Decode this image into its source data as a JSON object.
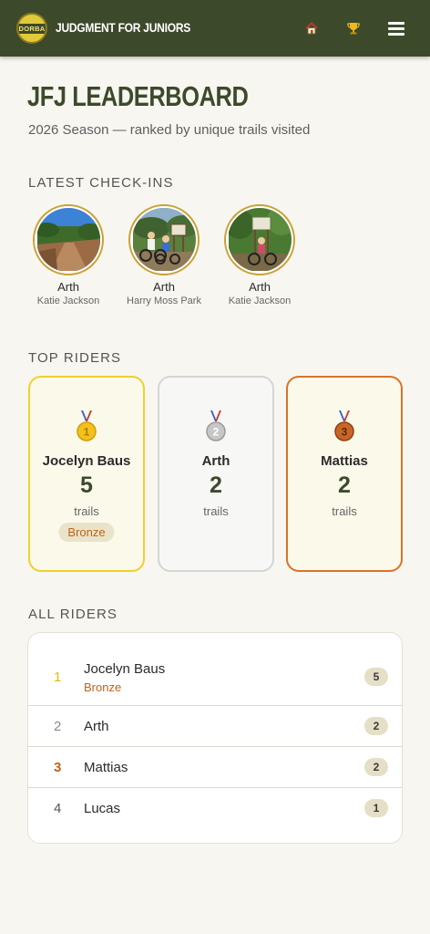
{
  "header": {
    "logo_text": "DORBA",
    "brand": "JUDGMENT FOR JUNIORS",
    "nav": [
      {
        "icon": "home-icon"
      },
      {
        "icon": "trophy-icon"
      },
      {
        "icon": "menu-icon"
      }
    ]
  },
  "page": {
    "title": "JFJ LEADERBOARD",
    "subtitle": "2026 Season — ranked by unique trails visited"
  },
  "checkins": {
    "label": "LATEST CHECK-INS",
    "items": [
      {
        "rider": "Arth",
        "trail": "Katie Jackson"
      },
      {
        "rider": "Arth",
        "trail": "Harry Moss Park"
      },
      {
        "rider": "Arth",
        "trail": "Katie Jackson"
      }
    ]
  },
  "top_riders": {
    "label": "TOP RIDERS",
    "cards": [
      {
        "place": "1",
        "name": "Jocelyn Baus",
        "count": "5",
        "unit": "trails",
        "badge": "Bronze"
      },
      {
        "place": "2",
        "name": "Arth",
        "count": "2",
        "unit": "trails"
      },
      {
        "place": "3",
        "name": "Mattias",
        "count": "2",
        "unit": "trails"
      }
    ]
  },
  "all_riders": {
    "label": "ALL RIDERS",
    "rows": [
      {
        "rank": "1",
        "name": "Jocelyn Baus",
        "badge": "Bronze",
        "count": "5"
      },
      {
        "rank": "2",
        "name": "Arth",
        "count": "2"
      },
      {
        "rank": "3",
        "name": "Mattias",
        "count": "2"
      },
      {
        "rank": "4",
        "name": "Lucas",
        "count": "1"
      }
    ]
  },
  "colors": {
    "header_bg": "#3c4a2b",
    "gold": "#f2cf2d",
    "silver": "#d5d5d5",
    "bronze": "#d8732a"
  }
}
